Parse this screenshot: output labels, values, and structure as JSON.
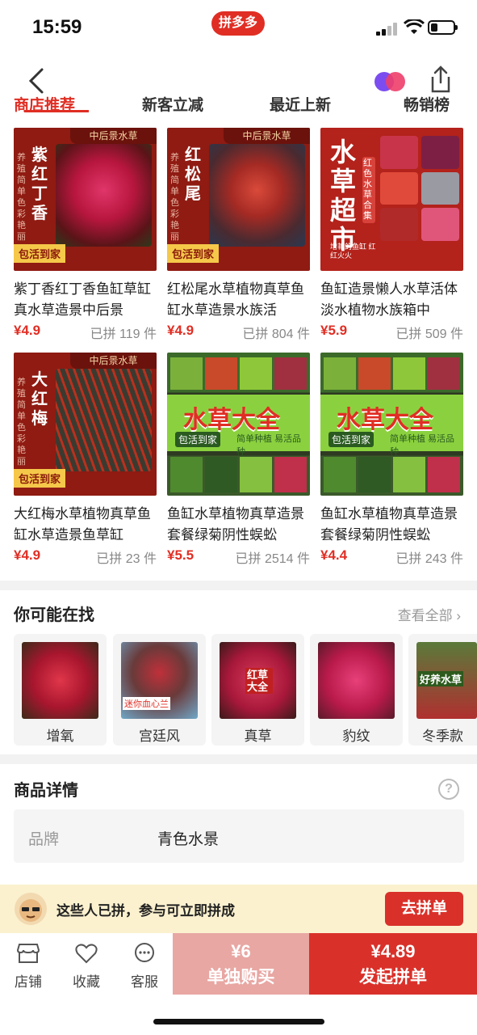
{
  "status": {
    "time": "15:59",
    "app_badge": "拼多多"
  },
  "tabs": [
    {
      "label": "商店推荐",
      "active": true
    },
    {
      "label": "新客立减",
      "active": false
    },
    {
      "label": "最近上新",
      "active": false
    },
    {
      "label": "畅销榜",
      "active": false
    }
  ],
  "products": [
    {
      "title": "紫丁香红丁香鱼缸草缸真水草造景中后景",
      "price": "¥4.9",
      "sold": "已拼 119 件",
      "img": {
        "banner": "中后景水草",
        "name": "紫红丁香",
        "side": "养殖简单 色彩艳丽",
        "tag": "包活到家"
      }
    },
    {
      "title": "红松尾水草植物真草鱼缸水草造景水族活",
      "price": "¥4.9",
      "sold": "已拼 804 件",
      "img": {
        "banner": "中后景水草",
        "name": "红松尾",
        "side": "养殖简单 色彩艳丽",
        "tag": "包活到家"
      }
    },
    {
      "title": "鱼缸造景懒人水草活体淡水植物水族箱中",
      "price": "¥5.9",
      "sold": "已拼 509 件",
      "img": {
        "big": "水草超市",
        "side": "红色水草合集",
        "bottom": "增艳的鱼缸 红红火火"
      }
    },
    {
      "title": "大红梅水草植物真草鱼缸水草造景鱼草缸",
      "price": "¥4.9",
      "sold": "已拼 23 件",
      "img": {
        "banner": "中后景水草",
        "name": "大红梅",
        "side": "养殖简单 色彩艳丽",
        "tag": "包活到家"
      }
    },
    {
      "title": "鱼缸水草植物真草造景套餐绿菊阴性蜈蚣",
      "price": "¥5.5",
      "sold": "已拼 2514 件",
      "img": {
        "big": "水草大全",
        "b1": "包活到家",
        "b2": "简单种植 易活品种"
      }
    },
    {
      "title": "鱼缸水草植物真草造景套餐绿菊阴性蜈蚣",
      "price": "¥4.4",
      "sold": "已拼 243 件",
      "img": {
        "big": "水草大全",
        "b1": "包活到家",
        "b2": "简单种植 易活品种"
      }
    }
  ],
  "find": {
    "title": "你可能在找",
    "more": "查看全部",
    "items": [
      {
        "label": "增氧"
      },
      {
        "label": "宫廷风",
        "caption": "迷你血心兰"
      },
      {
        "label": "真草",
        "caption": "红草大全"
      },
      {
        "label": "豹纹"
      },
      {
        "label": "冬季款",
        "caption": "好养水草"
      }
    ]
  },
  "detail": {
    "title": "商品详情",
    "help": "?",
    "brand_key": "品牌",
    "brand_value": "青色水景"
  },
  "group": {
    "text": "这些人已拼，参与可立即拼成",
    "button": "去拼单"
  },
  "bottom": {
    "shop": "店铺",
    "fav": "收藏",
    "service": "客服",
    "solo_price": "¥6",
    "solo_label": "单独购买",
    "group_price": "¥4.89",
    "group_label": "发起拼单"
  },
  "colors": {
    "brand": "#e02e24",
    "button_red": "#d9312a",
    "solo_pink": "#e8a7a3",
    "strip": "#fbf1cf"
  }
}
